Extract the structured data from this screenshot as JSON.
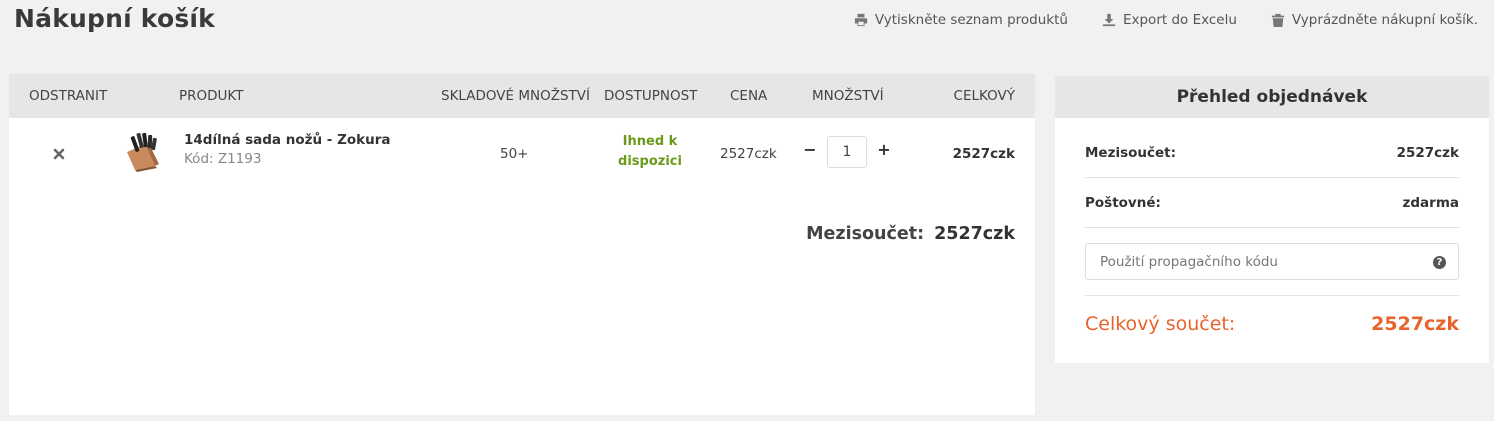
{
  "page": {
    "title": "Nákupní košík"
  },
  "actions": {
    "print_label": "Vytiskněte seznam produktů",
    "export_label": "Export do Excelu",
    "empty_label": "Vyprázdněte nákupní košík."
  },
  "table": {
    "headers": {
      "remove": "ODSTRANIT",
      "product": "PRODUKT",
      "stock": "SKLADOVÉ MNOŽSTVÍ",
      "availability": "DOSTUPNOST",
      "price": "CENA",
      "quantity": "MNOŽSTVÍ",
      "total": "CELKOVÝ"
    },
    "items": [
      {
        "name": "14dílná sada nožů - Zokura",
        "code": "Kód: Z1193",
        "stock": "50+",
        "availability": "Ihned k dispozici",
        "price": "2527czk",
        "quantity": "1",
        "total": "2527czk"
      }
    ],
    "subtotal_label": "Mezisoučet:",
    "subtotal_value": "2527czk"
  },
  "summary": {
    "title": "Přehled objednávek",
    "subtotal_label": "Mezisoučet:",
    "subtotal_value": "2527czk",
    "shipping_label": "Poštovné:",
    "shipping_value": "zdarma",
    "promo_placeholder": "Použití propagačního kódu",
    "help_symbol": "?",
    "grand_label": "Celkový součet:",
    "grand_value": "2527czk"
  },
  "qty_controls": {
    "minus": "−",
    "plus": "+"
  },
  "colors": {
    "accent": "#e8642c",
    "availability": "#6a9a18",
    "header_bg": "#e6e6e6",
    "page_bg": "#f1f1f1"
  },
  "icons": {
    "print": "printer-icon",
    "export": "download-icon",
    "empty": "trash-icon",
    "remove": "close-icon",
    "help": "question-circle-icon"
  }
}
